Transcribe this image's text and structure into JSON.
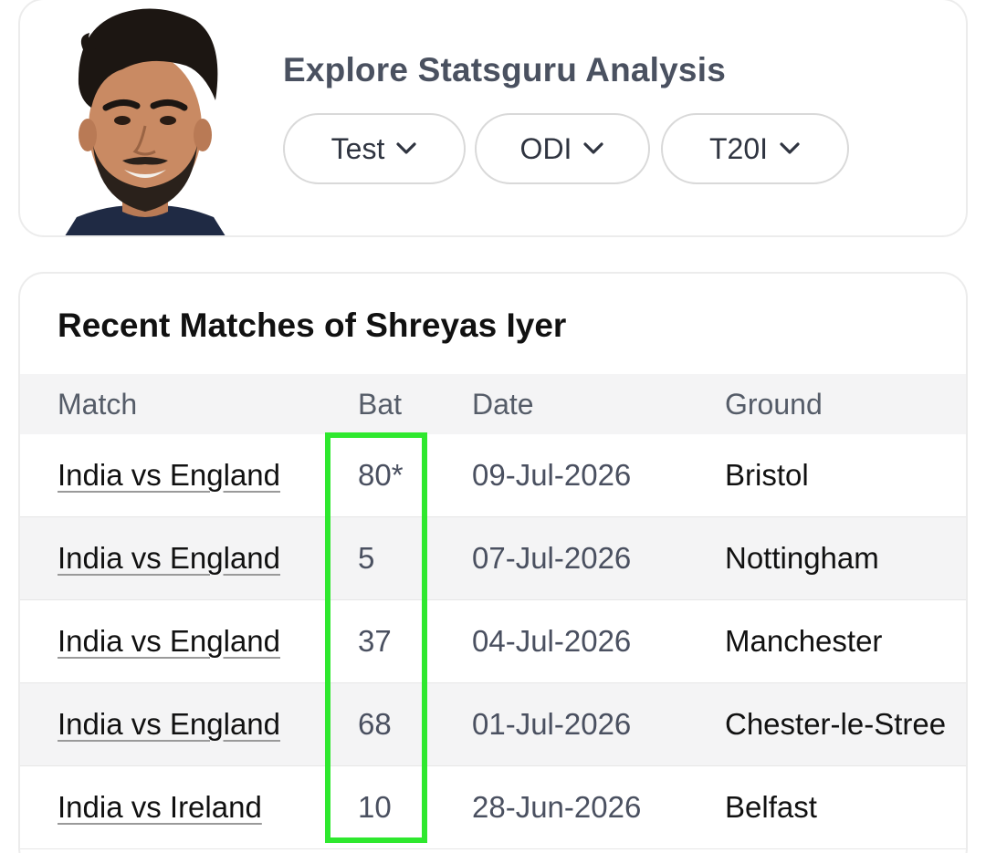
{
  "header": {
    "title": "Explore Statsguru Analysis",
    "formats": [
      {
        "label": "Test"
      },
      {
        "label": "ODI"
      },
      {
        "label": "T20I"
      }
    ]
  },
  "recent": {
    "title": "Recent Matches of Shreyas Iyer",
    "columns": [
      "Match",
      "Bat",
      "Date",
      "Ground"
    ],
    "rows": [
      {
        "match": "India vs England",
        "bat": "80*",
        "date": "09-Jul-2026",
        "ground": "Bristol"
      },
      {
        "match": "India vs England",
        "bat": "5",
        "date": "07-Jul-2026",
        "ground": "Nottingham"
      },
      {
        "match": "India vs England",
        "bat": "37",
        "date": "04-Jul-2026",
        "ground": "Manchester"
      },
      {
        "match": "India vs England",
        "bat": "68",
        "date": "01-Jul-2026",
        "ground": "Chester-le-Stree"
      },
      {
        "match": "India vs Ireland",
        "bat": "10",
        "date": "28-Jun-2026",
        "ground": "Belfast"
      }
    ]
  },
  "colors": {
    "highlight": "#2ee82e",
    "title_gray": "#4a5160",
    "stripe": "#f4f4f5"
  }
}
